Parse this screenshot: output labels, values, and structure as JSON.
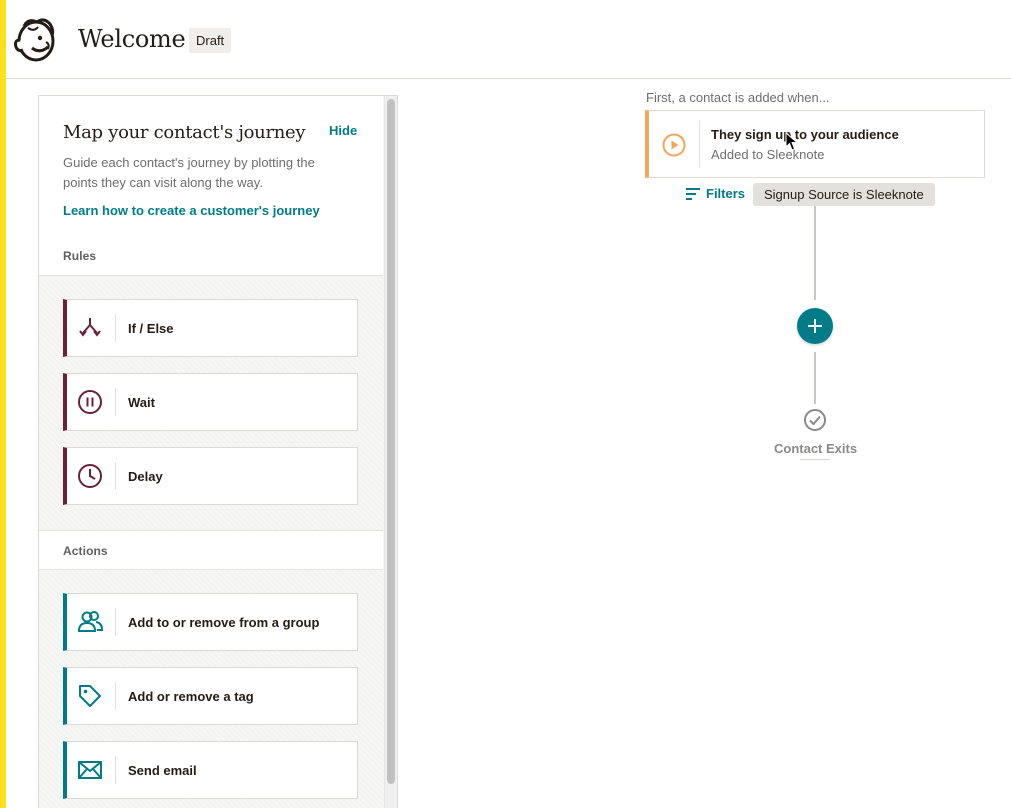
{
  "header": {
    "title": "Welcome",
    "status_badge": "Draft"
  },
  "panel": {
    "heading": "Map your contact's journey",
    "hide_label": "Hide",
    "description": "Guide each contact's journey by plotting the points they can visit along the way.",
    "learn_link": "Learn how to create a customer's journey",
    "rules": {
      "title": "Rules",
      "items": [
        {
          "label": "If / Else",
          "icon": "split-arrows-icon"
        },
        {
          "label": "Wait",
          "icon": "pause-icon"
        },
        {
          "label": "Delay",
          "icon": "clock-icon"
        }
      ]
    },
    "actions": {
      "title": "Actions",
      "items": [
        {
          "label": "Add to or remove from a group",
          "icon": "group-icon"
        },
        {
          "label": "Add or remove a tag",
          "icon": "tag-icon"
        },
        {
          "label": "Send email",
          "icon": "envelope-icon"
        }
      ]
    }
  },
  "flow": {
    "trigger_caption": "First, a contact is added when...",
    "trigger": {
      "title": "They sign up to your audience",
      "subtitle": "Added to Sleeknote",
      "icon": "play-circle-icon"
    },
    "filters_label": "Filters",
    "filter_chip": "Signup Source is Sleeknote",
    "exit_label": "Contact Exits"
  },
  "colors": {
    "accent_teal": "#007c89",
    "rule_border": "#6b1f3b",
    "trigger_border": "#f2a65a",
    "brand_yellow": "#ffe01b"
  }
}
